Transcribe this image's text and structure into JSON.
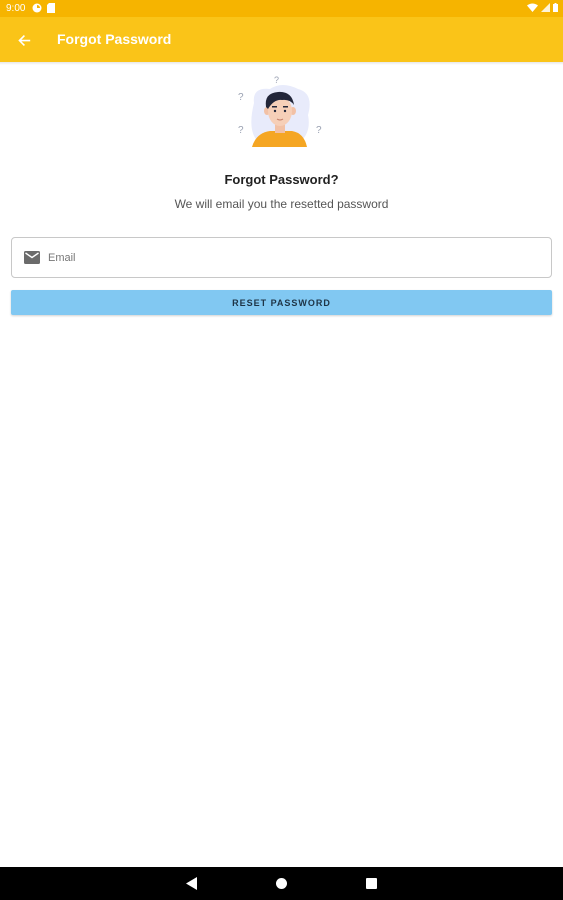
{
  "status_bar": {
    "time": "9:00",
    "icons": [
      "data-saver-icon",
      "sim-card-icon",
      "wifi-icon",
      "signal-icon",
      "battery-icon"
    ]
  },
  "app_bar": {
    "title": "Forgot Password",
    "back_icon": "arrow-back-icon",
    "color": "#fac418"
  },
  "main": {
    "illustration": "confused-person-illustration",
    "heading": "Forgot Password?",
    "subheading": "We will email you the resetted password",
    "email_field": {
      "icon": "mail-icon",
      "placeholder": "Email",
      "value": ""
    },
    "reset_button": {
      "label": "RESET PASSWORD",
      "color": "#81c8f2"
    }
  },
  "nav_bar": {
    "icons": [
      "nav-back-icon",
      "nav-home-icon",
      "nav-recents-icon"
    ]
  }
}
